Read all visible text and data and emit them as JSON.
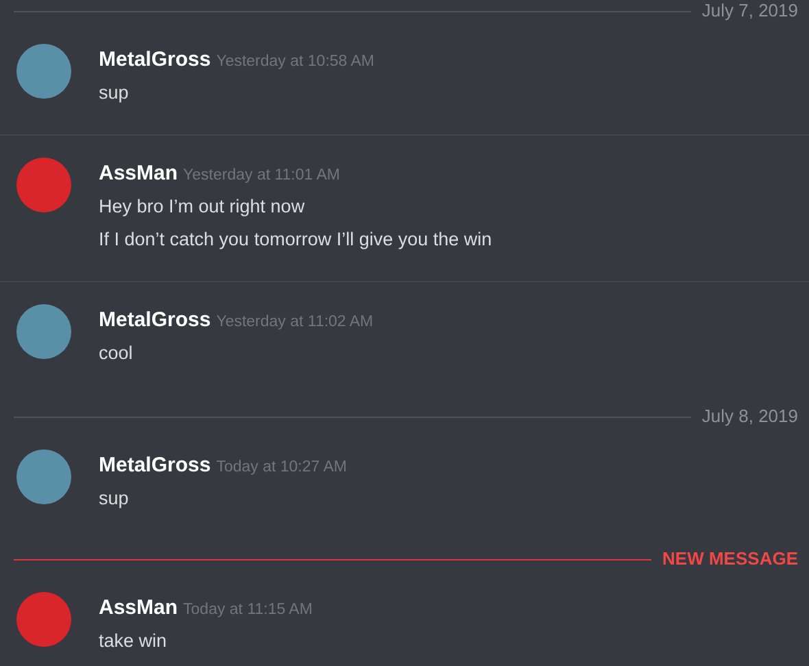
{
  "items": [
    {
      "kind": "date",
      "text": "July 7, 2019"
    },
    {
      "kind": "message",
      "author": "MetalGross",
      "color": "#5a8fa8",
      "time": "Yesterday at 10:58 AM",
      "lines": [
        "sup"
      ]
    },
    {
      "kind": "message",
      "author": "AssMan",
      "color": "#d8262b",
      "time": "Yesterday at 11:01 AM",
      "lines": [
        "Hey bro I’m out right now",
        "If I don’t catch you tomorrow I’ll give you the win"
      ]
    },
    {
      "kind": "message",
      "author": "MetalGross",
      "color": "#5a8fa8",
      "time": "Yesterday at 11:02 AM",
      "lines": [
        "cool"
      ]
    },
    {
      "kind": "date",
      "text": "July 8, 2019"
    },
    {
      "kind": "message",
      "author": "MetalGross",
      "color": "#5a8fa8",
      "time": "Today at 10:27 AM",
      "lines": [
        "sup"
      ]
    },
    {
      "kind": "new",
      "text": "NEW MESSAGE"
    },
    {
      "kind": "message",
      "author": "AssMan",
      "color": "#d8262b",
      "time": "Today at 11:15 AM",
      "lines": [
        "take win"
      ]
    }
  ]
}
